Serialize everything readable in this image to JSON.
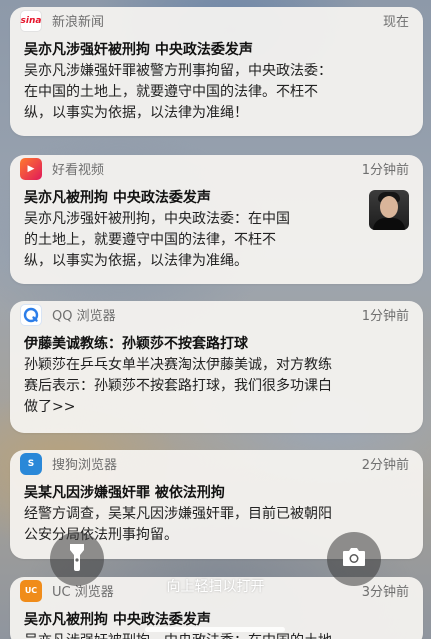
{
  "notifications": [
    {
      "app_name": "新浪新闻",
      "icon_text": "sina",
      "icon_color": "#e6162d",
      "time": "现在",
      "title": "吴亦凡涉强奸被刑拘 中央政法委发声",
      "body_lines": [
        "吴亦凡涉嫌强奸罪被警方刑事拘留，中央政法委：",
        "在中国的土地上，就要遵守中国的法律。不枉不",
        "纵，以事实为依据，以法律为准绳！"
      ]
    },
    {
      "app_name": "好看视频",
      "icon_text": "▶",
      "icon_color": "#ff4d2e",
      "time": "1分钟前",
      "title": "吴亦凡被刑拘 中央政法委发声",
      "body_lines": [
        "吴亦凡涉强奸被刑拘，中央政法委：在中国",
        "的土地上，就要遵守中国的法律，不枉不",
        "纵，以事实为依据，以法律为准绳。"
      ]
    },
    {
      "app_name": "QQ 浏览器",
      "icon_text": "Q",
      "icon_color": "#2b7de9",
      "time": "1分钟前",
      "title": "伊藤美诚教练：孙颖莎不按套路打球",
      "body_lines": [
        "孙颖莎在乒乓女单半决赛淘汰伊藤美诚，对方教练",
        "赛后表示：孙颖莎不按套路打球，我们很多功课白",
        "做了>>"
      ]
    },
    {
      "app_name": "搜狗浏览器",
      "icon_text": "S",
      "icon_color": "#2a88d8",
      "time": "2分钟前",
      "title": "吴某凡因涉嫌强奸罪 被依法刑拘",
      "body_lines": [
        "经警方调查，吴某凡因涉嫌强奸罪，目前已被朝阳",
        "公安分局依法刑事拘留。"
      ]
    },
    {
      "app_name": "UC 浏览器",
      "icon_text": "UC",
      "icon_color": "#f08c1a",
      "time": "3分钟前",
      "title": "吴亦凡被刑拘 中央政法委发声",
      "body_lines": [
        "吴亦凡涉强奸被刑拘，中央政法委：在中国的土地"
      ]
    }
  ],
  "lockscreen": {
    "unlock_hint": "向上轻扫以打开",
    "flashlight_icon": "flashlight-icon",
    "camera_icon": "camera-icon"
  }
}
